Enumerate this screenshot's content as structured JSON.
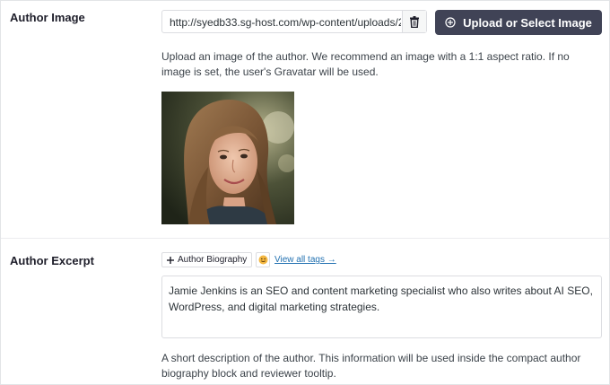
{
  "author_image": {
    "label": "Author Image",
    "url_value": "http://syedb33.sg-host.com/wp-content/uploads/2...",
    "upload_button_label": "Upload or Select Image",
    "help_text": "Upload an image of the author. We recommend an image with a 1:1 aspect ratio. If no image is set, the user's Gravatar will be used."
  },
  "author_excerpt": {
    "label": "Author Excerpt",
    "tag_button_label": "Author Biography",
    "view_tags_link": "View all tags →",
    "excerpt_text": "Jamie Jenkins is an SEO and content marketing specialist who also writes about AI SEO, WordPress, and digital marketing strategies.",
    "help_text": "A short description of the author. This information will be used inside the compact author biography block and reviewer tooltip."
  },
  "icons": {
    "trash": "trash-icon",
    "upload": "plus-circle-icon",
    "add": "plus-icon",
    "emoji": "emoji-icon"
  },
  "colors": {
    "primary_button": "#404356",
    "link": "#2271b1"
  }
}
